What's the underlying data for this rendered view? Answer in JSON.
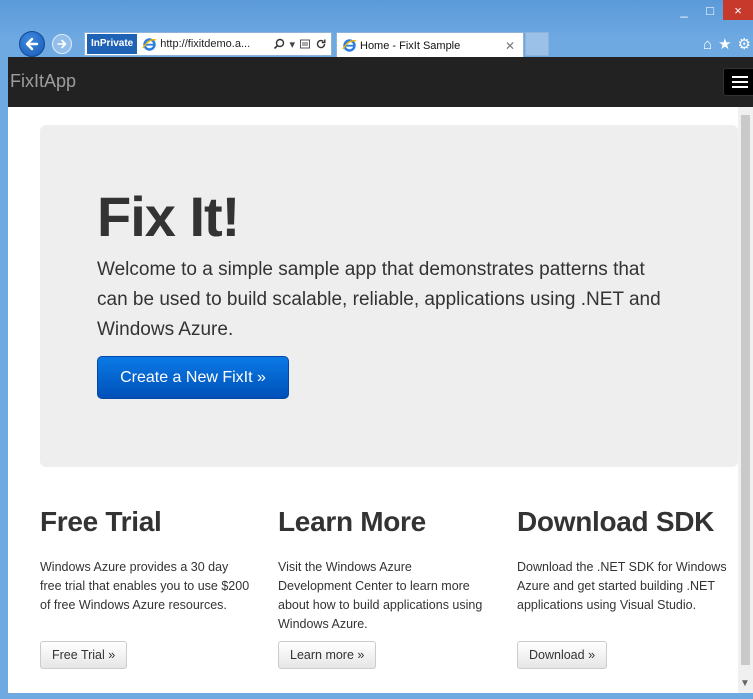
{
  "browser": {
    "inprivate_label": "InPrivate",
    "address_url": "http://fixitdemo.a...",
    "tab_title": "Home - FixIt Sample",
    "window_controls": {
      "minimize": "_",
      "maximize": "□",
      "close": "×"
    }
  },
  "navbar": {
    "brand": "FixItApp"
  },
  "hero": {
    "title": "Fix It!",
    "lead": "Welcome to a simple sample app that demonstrates patterns that can be used to build scalable, reliable, applications using .NET and Windows Azure.",
    "button_label": "Create a New FixIt »"
  },
  "columns": [
    {
      "heading": "Free Trial",
      "text": "Windows Azure provides a 30 day free trial that enables you to use $200 of free Windows Azure resources.",
      "button_label": "Free Trial »"
    },
    {
      "heading": "Learn More",
      "text": "Visit the Windows Azure Development Center to learn more about how to build applications using Windows Azure.",
      "button_label": "Learn more »"
    },
    {
      "heading": "Download SDK",
      "text": "Download the .NET SDK for Windows Azure and get started building .NET applications using Visual Studio.",
      "button_label": "Download »"
    }
  ],
  "colors": {
    "navbar_bg": "#222222",
    "primary_button": "#0a6fd8",
    "jumbotron_bg": "#eeeeee",
    "chrome_blue": "#6ea9e2"
  }
}
